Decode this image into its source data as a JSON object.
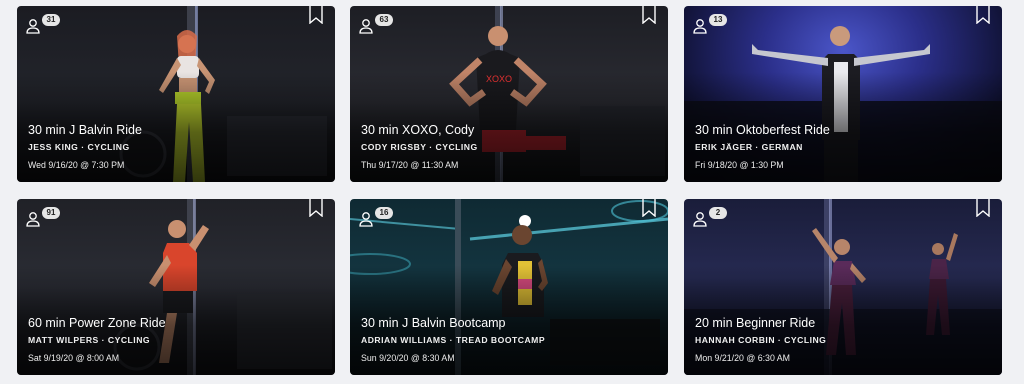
{
  "classes": [
    {
      "riders": "31",
      "title": "30 min J Balvin Ride",
      "instructor": "JESS KING",
      "category": "CYCLING",
      "date": "Wed 9/16/20 @ 7:30 PM"
    },
    {
      "riders": "63",
      "title": "30 min XOXO, Cody",
      "instructor": "CODY RIGSBY",
      "category": "CYCLING",
      "date": "Thu 9/17/20 @ 11:30 AM"
    },
    {
      "riders": "13",
      "title": "30 min Oktoberfest Ride",
      "instructor": "ERIK JÄGER",
      "category": "GERMAN",
      "date": "Fri 9/18/20 @ 1:30 PM"
    },
    {
      "riders": "91",
      "title": "60 min Power Zone Ride",
      "instructor": "MATT WILPERS",
      "category": "CYCLING",
      "date": "Sat 9/19/20 @ 8:00 AM"
    },
    {
      "riders": "16",
      "title": "30 min J Balvin Bootcamp",
      "instructor": "ADRIAN WILLIAMS",
      "category": "TREAD BOOTCAMP",
      "date": "Sun 9/20/20 @ 8:30 AM"
    },
    {
      "riders": "2",
      "title": "20 min Beginner Ride",
      "instructor": "HANNAH CORBIN",
      "category": "CYCLING",
      "date": "Mon 9/21/20 @ 6:30 AM"
    }
  ],
  "separator": " · "
}
